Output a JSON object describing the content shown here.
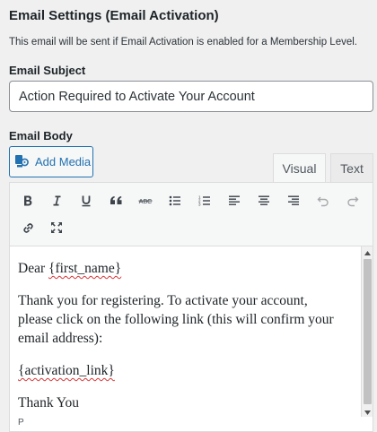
{
  "section": {
    "title": "Email Settings (Email Activation)",
    "description": "This email will be sent if Email Activation is enabled for a Membership Level."
  },
  "subject": {
    "label": "Email Subject",
    "value": "Action Required to Activate Your Account"
  },
  "body": {
    "label": "Email Body",
    "add_media_label": "Add Media",
    "tabs": {
      "visual": "Visual",
      "text": "Text"
    },
    "toolbar": [
      "bold-icon",
      "italic-icon",
      "underline-icon",
      "blockquote-icon",
      "strikethrough-icon",
      "bullet-list-icon",
      "numbered-list-icon",
      "align-left-icon",
      "align-center-icon",
      "align-right-icon",
      "undo-icon",
      "redo-icon",
      "link-icon",
      "fullscreen-icon"
    ],
    "content": {
      "greeting_prefix": "Dear ",
      "greeting_token": "{first_name}",
      "paragraph": "Thank you for registering. To activate your account, please click on the following link (this will confirm your email address):",
      "activation_token": "{activation_link}",
      "signoff": "Thank You"
    },
    "status_path": "P"
  },
  "colors": {
    "accent": "#2271b1",
    "border": "#dcdcde",
    "spellcheck": "#d63638"
  }
}
